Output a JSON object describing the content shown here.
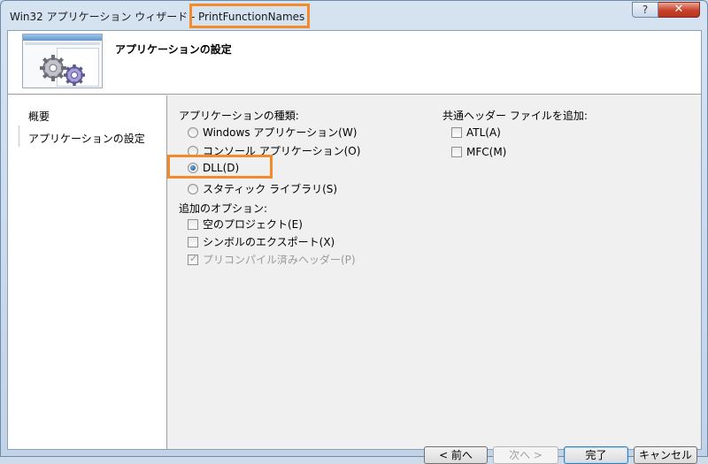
{
  "window": {
    "title": "Win32 アプリケーション ウィザード - ",
    "title_project": "PrintFunctionNames",
    "help_glyph": "?",
    "close_glyph": "✕"
  },
  "header": {
    "title": "アプリケーションの設定"
  },
  "nav": {
    "items": [
      {
        "label": "概要"
      },
      {
        "label": "アプリケーションの設定"
      }
    ]
  },
  "app_type": {
    "label": "アプリケーションの種類:",
    "options": [
      {
        "label": "Windows アプリケーション(W)",
        "selected": false
      },
      {
        "label": "コンソール アプリケーション(O)",
        "selected": false
      },
      {
        "label": "DLL(D)",
        "selected": true
      },
      {
        "label": "スタティック ライブラリ(S)",
        "selected": false
      }
    ]
  },
  "extra_options": {
    "label": "追加のオプション:",
    "options": [
      {
        "label": "空のプロジェクト(E)",
        "checked": false,
        "enabled": true
      },
      {
        "label": "シンボルのエクスポート(X)",
        "checked": false,
        "enabled": true
      },
      {
        "label": "プリコンパイル済みヘッダー(P)",
        "checked": true,
        "enabled": false
      }
    ]
  },
  "common_headers": {
    "label": "共通ヘッダー ファイルを追加:",
    "options": [
      {
        "label": "ATL(A)",
        "checked": false
      },
      {
        "label": "MFC(M)",
        "checked": false
      }
    ]
  },
  "buttons": {
    "back": "< 前へ",
    "next": "次へ >",
    "finish": "完了",
    "cancel": "キャンセル"
  },
  "colors": {
    "highlight": "#f28b2b",
    "radio_selected": "#1b4f93"
  }
}
